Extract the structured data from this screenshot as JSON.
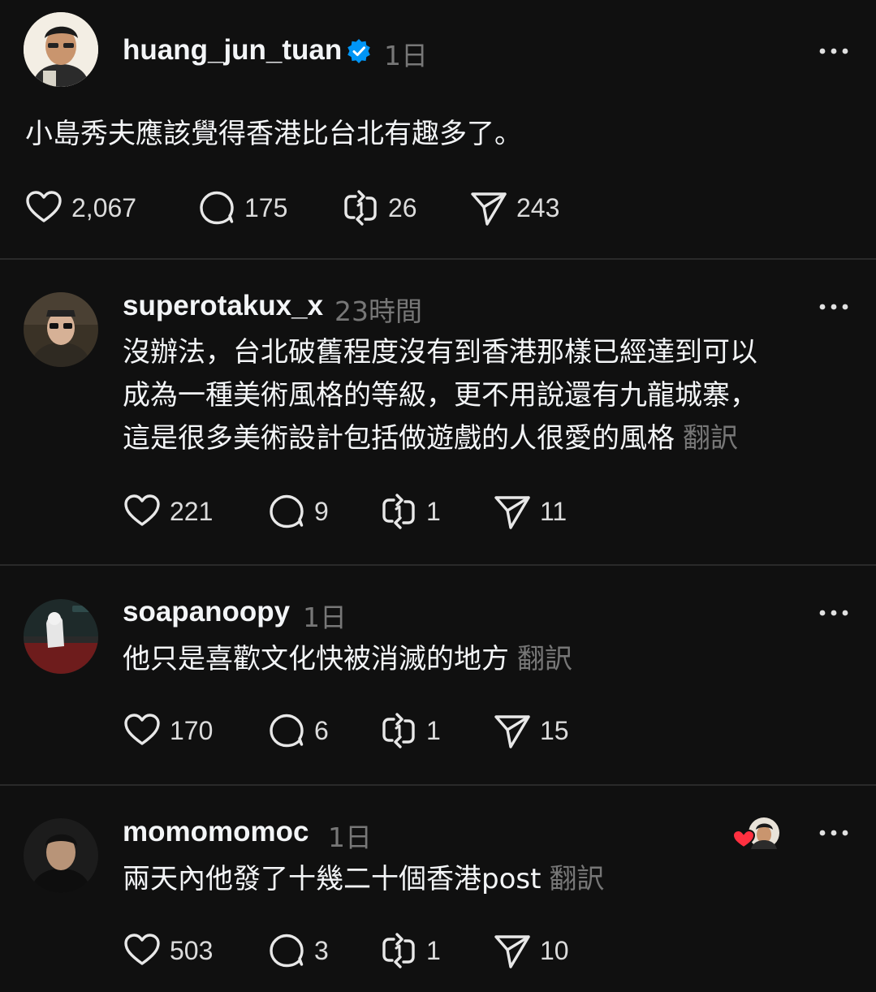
{
  "posts": [
    {
      "username": "huang_jun_tuan",
      "verified": true,
      "time": "1日",
      "text": "小島秀夫應該覺得香港比台北有趣多了。",
      "translate": "",
      "likes": "2,067",
      "replies": "175",
      "reposts": "26",
      "shares": "243"
    },
    {
      "username": "superotakux_x",
      "time": "23時間",
      "lines": [
        "沒辦法，台北破舊程度沒有到香港那樣已經達到可以",
        "成為一種美術風格的等級，更不用說還有九龍城寨，",
        "這是很多美術設計包括做遊戲的人很愛的風格"
      ],
      "translate": "翻訳",
      "likes": "221",
      "replies": "9",
      "reposts": "1",
      "shares": "11"
    },
    {
      "username": "soapanoopy",
      "time": "1日",
      "text": "他只是喜歡文化快被消滅的地方",
      "translate": "翻訳",
      "likes": "170",
      "replies": "6",
      "reposts": "1",
      "shares": "15"
    },
    {
      "username": "momomomoc",
      "time": "1日",
      "text": "兩天內他發了十幾二十個香港post",
      "translate": "翻訳",
      "likes": "503",
      "replies": "3",
      "reposts": "1",
      "shares": "10",
      "liked_by_author": true
    }
  ],
  "icons": {
    "like": "heart-outline-icon",
    "reply": "speech-bubble-icon",
    "repost": "repost-arrows-icon",
    "share": "paper-plane-icon",
    "more": "ellipsis-icon",
    "verified": "verified-badge-icon"
  },
  "colors": {
    "background": "#101010",
    "text": "#f3f5f7",
    "muted": "#777777",
    "verified": "#0095f6",
    "liked_heart": "#ff3040"
  }
}
